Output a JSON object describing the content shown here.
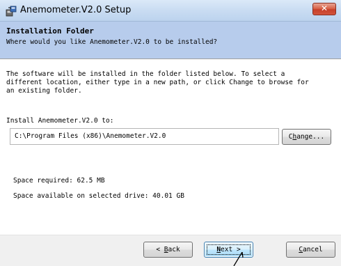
{
  "window": {
    "title": "Anemometer.V2.0 Setup",
    "close_glyph": "✕"
  },
  "header": {
    "title": "Installation Folder",
    "subtitle": "Where would you like Anemometer.V2.0 to be installed?"
  },
  "body": {
    "description": "The software will be installed in the folder listed below. To select a\ndifferent location, either type in a new path, or click Change to browse for\nan existing folder.",
    "folder_label": "Install Anemometer.V2.0 to:",
    "install_path": "C:\\Program Files (x86)\\Anemometer.V2.0",
    "change_button": {
      "pre": "C",
      "key": "h",
      "post": "ange..."
    },
    "space_required": "Space required: 62.5 MB",
    "space_available": "Space available on selected drive: 40.01 GB"
  },
  "footer": {
    "back_button": {
      "arrow": "<",
      "key": "B",
      "post": "ack"
    },
    "next_button": {
      "key": "N",
      "post": "ext",
      "arrow": ">"
    },
    "cancel_button": {
      "key": "C",
      "post": "ancel"
    }
  },
  "icons": {
    "app": "installer-package-icon",
    "close": "close-icon",
    "cursor": "mouse-pointer-icon"
  },
  "colors": {
    "header_bg": "#b7ccec",
    "close_red": "#c7402a",
    "next_border": "#3c7fb1"
  }
}
